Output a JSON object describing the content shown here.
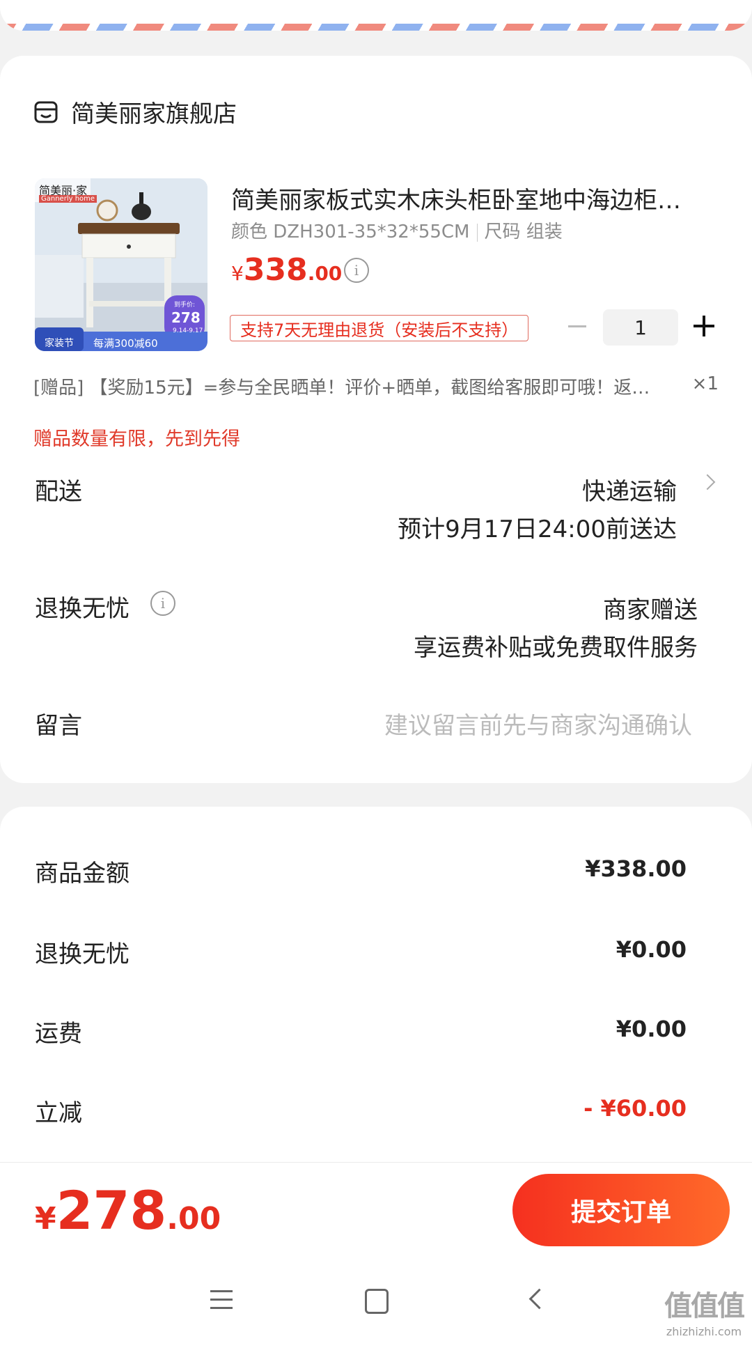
{
  "shop": {
    "name": "简美丽家旗舰店"
  },
  "product": {
    "title": "简美丽家板式实木床头柜卧室地中海边柜…",
    "spec_color": "颜色 DZH301-35*32*55CM",
    "spec_size": "尺码 组装",
    "price_currency": "¥",
    "price_int": "338",
    "price_dec": ".00",
    "quantity": "1",
    "return_badge": "支持7天无理由退货（安装后不支持）",
    "thumb": {
      "brand": "简美丽·家",
      "brand_sub": "Gannerly home",
      "promo_label": "到手价:",
      "promo_price": "278",
      "promo_date": "9.14-9.17",
      "festival": "家装节",
      "discount": "每满300减60"
    }
  },
  "gift": {
    "text": "[赠品] 【奖励15元】=参与全民晒单！评价+晒单，截图给客服即可哦！返…",
    "count": "×1",
    "note": "赠品数量有限，先到先得"
  },
  "delivery": {
    "label": "配送",
    "method": "快递运输",
    "eta": "预计9月17日24:00前送达"
  },
  "returns": {
    "label": "退换无忧",
    "provider": "商家赠送",
    "desc": "享运费补贴或免费取件服务"
  },
  "message": {
    "label": "留言",
    "placeholder": "建议留言前先与商家沟通确认"
  },
  "summary": [
    {
      "label": "商品金额",
      "value": "¥338.00"
    },
    {
      "label": "退换无忧",
      "value": "¥0.00"
    },
    {
      "label": "运费",
      "value": "¥0.00"
    },
    {
      "label": "立减",
      "value": "- ¥60.00"
    }
  ],
  "footer": {
    "total_currency": "¥",
    "total_int": "278",
    "total_dec": ".00",
    "submit_label": "提交订单"
  },
  "watermark": {
    "logo": "值值值",
    "url": "zhizhizhi.com"
  },
  "colors": {
    "accent": "#e62e1f",
    "submit_start": "#f5301f",
    "submit_end": "#ff6a2a"
  }
}
